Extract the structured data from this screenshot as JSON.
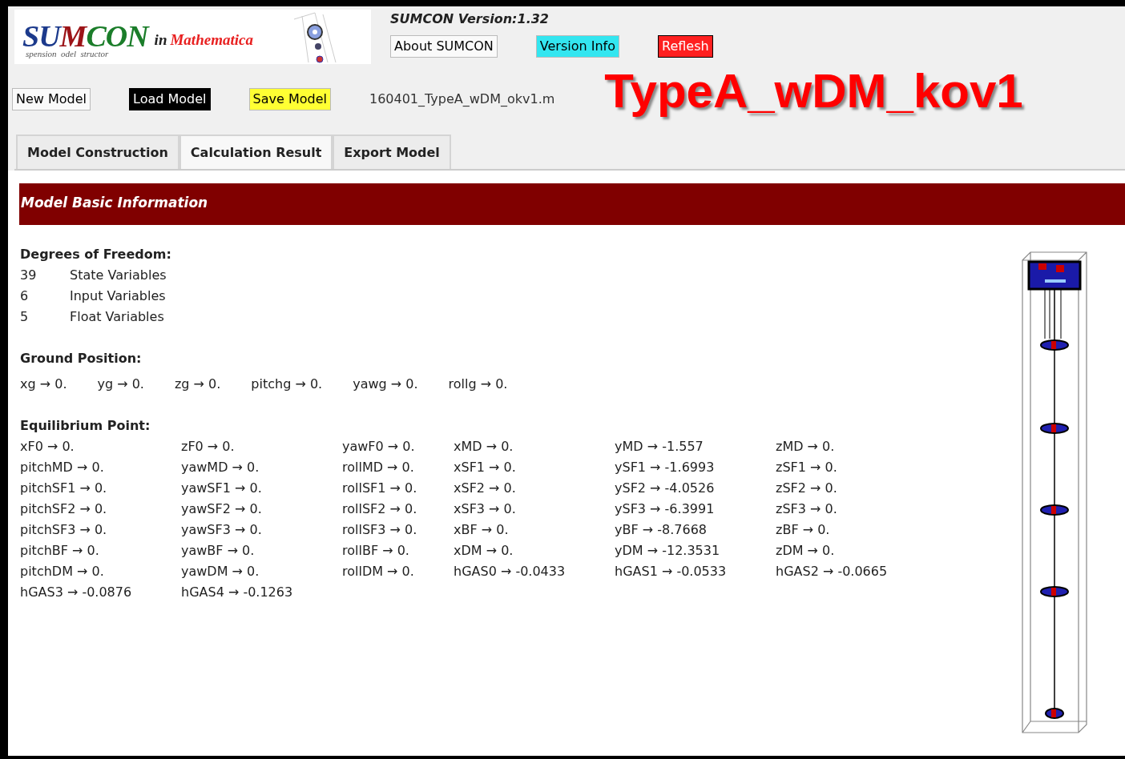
{
  "logo": {
    "title_parts": [
      {
        "text": "SU",
        "color": "#1c3a8c"
      },
      {
        "text": "M",
        "color": "#9c1418"
      },
      {
        "text": "CON",
        "color": "#1b7d2a"
      }
    ],
    "in": "in",
    "product": "Mathematica",
    "subtitle": [
      "spension",
      "odel",
      "structor"
    ]
  },
  "version": "SUMCON Version:1.32",
  "top_buttons": [
    {
      "label": "About SUMCON",
      "color": "#fafafa"
    },
    {
      "label": "Version Info",
      "color": "#33e6f0"
    },
    {
      "label": "Reflesh",
      "color": "#ff2020"
    }
  ],
  "model_buttons": [
    {
      "label": "New Model",
      "color": "#fafafa"
    },
    {
      "label": "Load Model",
      "color": "#000000"
    },
    {
      "label": "Save Model",
      "color": "#ffff33"
    }
  ],
  "file_name": "160401_TypeA_wDM_okv1.m",
  "model_title": "TypeA_wDM_kov1",
  "tabs": [
    {
      "label": "Model Construction",
      "selected": false
    },
    {
      "label": "Calculation Result",
      "selected": true
    },
    {
      "label": "Export Model",
      "selected": false
    }
  ],
  "banner": "Model Basic Information",
  "degrees_of_freedom": {
    "heading": "Degrees of Freedom:",
    "rows": [
      {
        "count": "39",
        "label": "State Variables"
      },
      {
        "count": "6",
        "label": "Input Variables"
      },
      {
        "count": "5",
        "label": "Float Variables"
      }
    ]
  },
  "ground_position": {
    "heading": "Ground Position:",
    "items": [
      "xg → 0.",
      "yg → 0.",
      "zg → 0.",
      "pitchg → 0.",
      "yawg → 0.",
      "rollg → 0."
    ]
  },
  "equilibrium_point": {
    "heading": "Equilibrium Point:",
    "rows": [
      [
        "xF0 → 0.",
        "zF0 → 0.",
        "yawF0 → 0.",
        "xMD → 0.",
        "yMD → -1.557",
        "zMD → 0."
      ],
      [
        "pitchMD → 0.",
        "yawMD → 0.",
        "rollMD → 0.",
        "xSF1 → 0.",
        "ySF1 → -1.6993",
        "zSF1 → 0."
      ],
      [
        "pitchSF1 → 0.",
        "yawSF1 → 0.",
        "rollSF1 → 0.",
        "xSF2 → 0.",
        "ySF2 → -4.0526",
        "zSF2 → 0."
      ],
      [
        "pitchSF2 → 0.",
        "yawSF2 → 0.",
        "rollSF2 → 0.",
        "xSF3 → 0.",
        "ySF3 → -6.3991",
        "zSF3 → 0."
      ],
      [
        "pitchSF3 → 0.",
        "yawSF3 → 0.",
        "rollSF3 → 0.",
        "xBF → 0.",
        "yBF → -8.7668",
        "zBF → 0."
      ],
      [
        "pitchBF → 0.",
        "yawBF → 0.",
        "rollBF → 0.",
        "xDM → 0.",
        "yDM → -12.3531",
        "zDM → 0."
      ],
      [
        "pitchDM → 0.",
        "yawDM → 0.",
        "rollDM → 0.",
        "hGAS0 → -0.0433",
        "hGAS1 → -0.0533",
        "hGAS2 → -0.0665"
      ],
      [
        "hGAS3 → -0.0876",
        "hGAS4 → -0.1263"
      ]
    ]
  }
}
